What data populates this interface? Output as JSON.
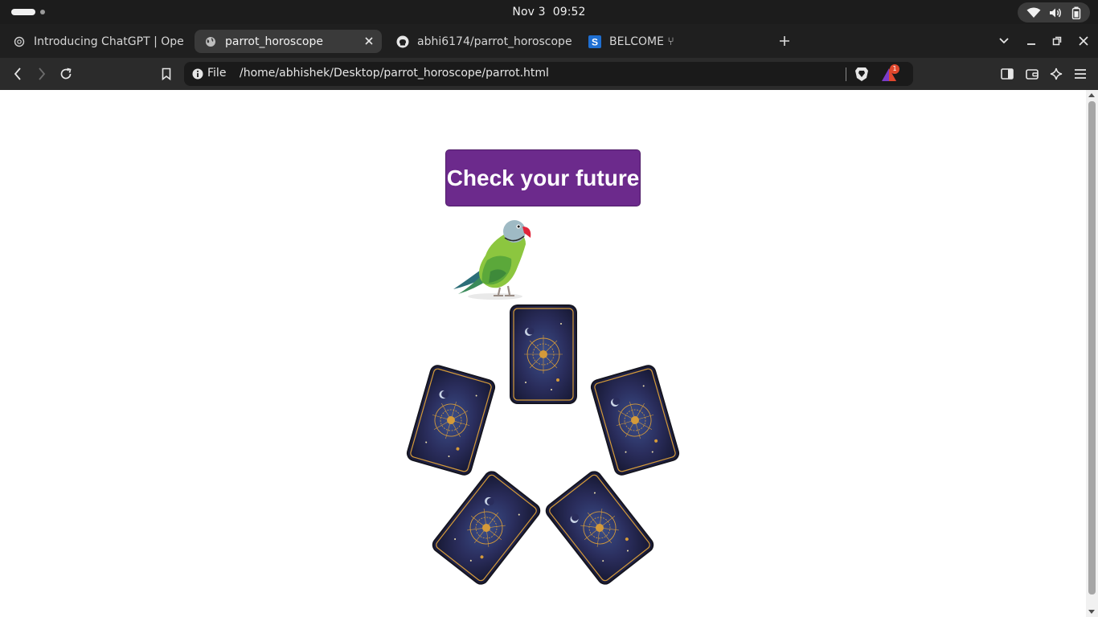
{
  "system_bar": {
    "date": "Nov 3",
    "time": "09:52",
    "icons": [
      "wifi-icon",
      "volume-icon",
      "battery-icon"
    ]
  },
  "tabs": [
    {
      "title": "Introducing ChatGPT | Open",
      "icon": "openai-icon",
      "active": false
    },
    {
      "title": "parrot_horoscope",
      "icon": "globe-icon",
      "active": true
    },
    {
      "title": "abhi6174/parrot_horoscope",
      "icon": "github-icon",
      "active": false
    },
    {
      "title": "BELCOME ⑂",
      "icon": "s-icon",
      "active": false
    }
  ],
  "toolbar": {
    "scheme_label": "File",
    "url": "/home/abhishek/Desktop/parrot_horoscope/parrot.html",
    "rewards_badge": "1"
  },
  "page": {
    "button_label": "Check your future",
    "image_alt": "parrot",
    "card_count": 5
  },
  "colors": {
    "button_bg": "#6c2a8c",
    "card_back": "#1a1c3a",
    "card_gold": "#d49a3a"
  }
}
